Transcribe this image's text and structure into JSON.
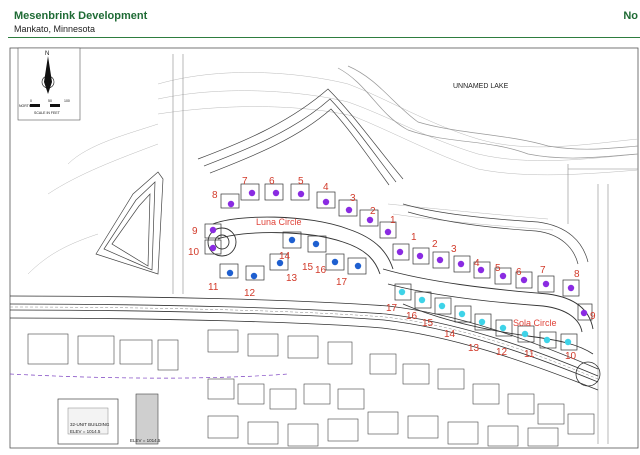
{
  "header": {
    "company": "Mesenbrink Development",
    "city": "Mankato, Minnesota",
    "corner_text": "No"
  },
  "map": {
    "lake_label": "UNNAMED LAKE",
    "street_labels": {
      "luna": "Luna Circle",
      "sola": "Sola Circle"
    },
    "compass": {
      "north_letter": "N",
      "scale_left": "NORTH",
      "scale_ticks": [
        "0",
        "50",
        "100"
      ],
      "scale_caption": "SCALE IN FEET"
    },
    "building_labels": {
      "unit_bldg": "32-UNIT BUILDING",
      "elev1": "ELEV = 1014.5",
      "elev2": "ELEV = 1014.5"
    },
    "colors": {
      "purple": "#8a2be2",
      "blue": "#1e5fd0",
      "cyan": "#3ed3e8",
      "number_red": "#d23a2a",
      "street_red": "#e0443a"
    },
    "lot_numbers": [
      {
        "id": "l8",
        "text": "8"
      },
      {
        "id": "l7",
        "text": "7"
      },
      {
        "id": "l6",
        "text": "6"
      },
      {
        "id": "l5",
        "text": "5"
      },
      {
        "id": "l4",
        "text": "4"
      },
      {
        "id": "l3",
        "text": "3"
      },
      {
        "id": "l2",
        "text": "2"
      },
      {
        "id": "l1a",
        "text": "1"
      },
      {
        "id": "l9",
        "text": "9"
      },
      {
        "id": "l10",
        "text": "10"
      },
      {
        "id": "l11",
        "text": "11"
      },
      {
        "id": "l12",
        "text": "12"
      },
      {
        "id": "l13",
        "text": "13"
      },
      {
        "id": "l14",
        "text": "14"
      },
      {
        "id": "l15",
        "text": "15"
      },
      {
        "id": "l16",
        "text": "16"
      },
      {
        "id": "l17",
        "text": "17"
      },
      {
        "id": "r1",
        "text": "1"
      },
      {
        "id": "r2",
        "text": "2"
      },
      {
        "id": "r3",
        "text": "3"
      },
      {
        "id": "r4",
        "text": "4"
      },
      {
        "id": "r5",
        "text": "5"
      },
      {
        "id": "r6",
        "text": "6"
      },
      {
        "id": "r7",
        "text": "7"
      },
      {
        "id": "r8",
        "text": "8"
      },
      {
        "id": "r9",
        "text": "9"
      },
      {
        "id": "r10",
        "text": "10"
      },
      {
        "id": "r11",
        "text": "11"
      },
      {
        "id": "r12",
        "text": "12"
      },
      {
        "id": "r13",
        "text": "13"
      },
      {
        "id": "r14",
        "text": "14"
      },
      {
        "id": "r15",
        "text": "15"
      },
      {
        "id": "r16",
        "text": "16"
      },
      {
        "id": "r17",
        "text": "17"
      }
    ]
  }
}
